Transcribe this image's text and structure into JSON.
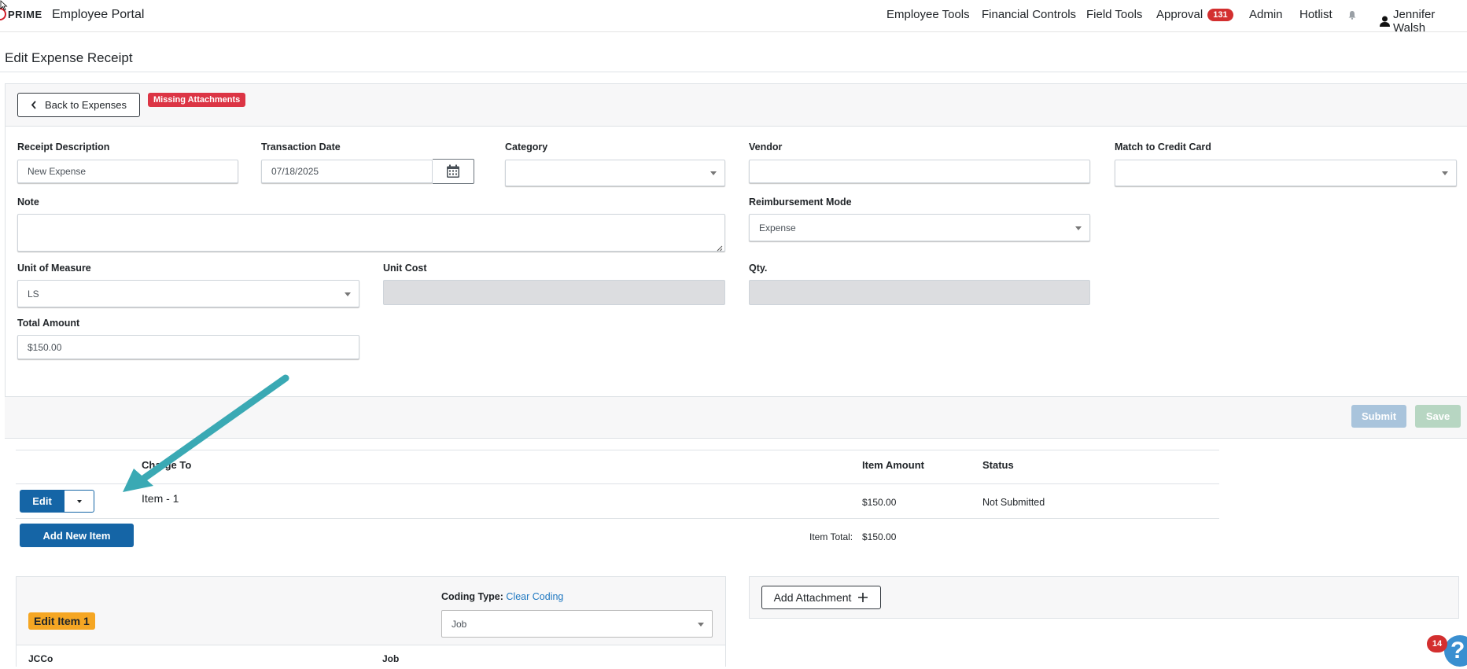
{
  "navbar": {
    "logo_text": "PRIME",
    "app_title": "Employee Portal",
    "items": {
      "employee_tools": "Employee Tools",
      "financial_controls": "Financial Controls",
      "field_tools": "Field Tools",
      "approval": "Approval",
      "approval_count": "131",
      "admin": "Admin",
      "hotlist": "Hotlist"
    },
    "bell_icon": "bell-icon",
    "user_icon": "user-icon",
    "user_name": "Jennifer Walsh"
  },
  "page": {
    "title": "Edit Expense Receipt"
  },
  "header_actions": {
    "back_label": "Back to Expenses",
    "status_badge": "Missing Attachments"
  },
  "form": {
    "receipt_description": {
      "label": "Receipt Description",
      "value": "New Expense"
    },
    "transaction_date": {
      "label": "Transaction Date",
      "value": "07/18/2025"
    },
    "category": {
      "label": "Category",
      "value": ""
    },
    "vendor": {
      "label": "Vendor",
      "value": ""
    },
    "match_credit_card": {
      "label": "Match to Credit Card",
      "value": ""
    },
    "note": {
      "label": "Note",
      "value": ""
    },
    "reimbursement_mode": {
      "label": "Reimbursement Mode",
      "value": "Expense"
    },
    "unit_of_measure": {
      "label": "Unit of Measure",
      "value": "LS"
    },
    "unit_cost": {
      "label": "Unit Cost",
      "value": ""
    },
    "qty": {
      "label": "Qty.",
      "value": ""
    },
    "total_amount": {
      "label": "Total Amount",
      "value": "$150.00"
    }
  },
  "footer_actions": {
    "submit_label": "Submit",
    "save_label": "Save"
  },
  "items_table": {
    "headers": {
      "charge_to": "Charge To",
      "item_amount": "Item Amount",
      "status": "Status"
    },
    "rows": [
      {
        "edit_label": "Edit",
        "charge_to": "Item - 1",
        "item_amount": "$150.00",
        "status": "Not Submitted"
      }
    ],
    "add_item_label": "Add New Item",
    "total_label": "Item Total:",
    "total_value": "$150.00"
  },
  "coding_panel": {
    "badge": "Edit Item 1",
    "coding_type_label": "Coding Type:",
    "clear_coding_link": "Clear Coding",
    "coding_type_value": "Job",
    "col_jcco": "JCCo",
    "col_job": "Job"
  },
  "attachment_panel": {
    "add_attachment_label": "Add Attachment"
  },
  "help": {
    "count": "14"
  },
  "colors": {
    "primary": "#1565a6",
    "danger": "#dc3545",
    "warning": "#f5a623",
    "annotation_arrow": "#3aa9b4"
  }
}
